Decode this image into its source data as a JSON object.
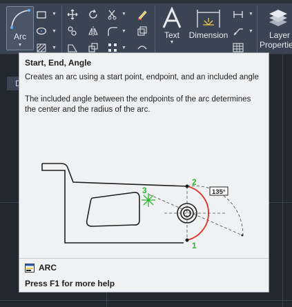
{
  "ribbon": {
    "arc_label": "Arc",
    "text_label": "Text",
    "dimension_label": "Dimension",
    "layer_label_line1": "Layer",
    "layer_label_line2": "Properties"
  },
  "icons": {
    "arc": "arc-icon",
    "rectangle": "rectangle-icon",
    "ellipse": "ellipse-icon",
    "hatch": "hatch-icon",
    "move": "move-icon",
    "rotate": "rotate-icon",
    "trim": "trim-icon",
    "erase": "erase-icon",
    "copy": "copy-icon",
    "mirror": "mirror-icon",
    "fillet": "fillet-icon",
    "offset": "offset-icon",
    "stretch": "stretch-icon",
    "scale": "scale-icon",
    "array": "array-icon",
    "text": "text-icon",
    "dimension": "dimension-icon",
    "linear": "linear-dim-icon",
    "leader": "leader-icon",
    "table": "table-icon",
    "layers": "layers-icon"
  },
  "doc_tab_letter": "D",
  "tooltip": {
    "title": "Start, End, Angle",
    "description": "Creates an arc using a start point, endpoint, and an included angle",
    "detail": "The included angle between the endpoints of the arc determines the center and the radius of the arc.",
    "figure": {
      "point1": "1",
      "point2": "2",
      "point3": "3",
      "angle": "135°"
    },
    "command": "ARC",
    "help": "Press F1 for more help"
  },
  "colors": {
    "ribbon": "#3b4453",
    "canvas": "#212830",
    "tooltip_bg": "#f0f1f3",
    "point_green": "#2bb52b",
    "arc_red": "#e03020"
  }
}
